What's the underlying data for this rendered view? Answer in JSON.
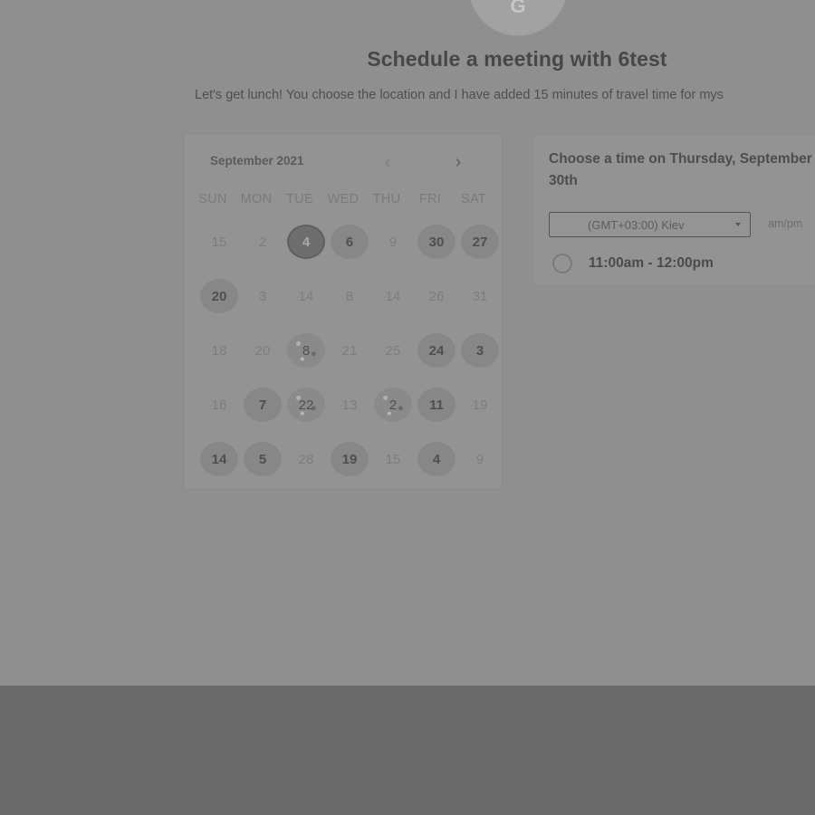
{
  "header": {
    "avatar_glyph": "G",
    "title": "Schedule a meeting with 6test",
    "description": "Let's get lunch! You choose the location and I have added 15 minutes of travel time for mys"
  },
  "calendar": {
    "month_label": "September 2021",
    "prev_icon": "chevron-left-icon",
    "next_icon": "chevron-right-icon",
    "prev_glyph": "‹",
    "next_glyph": "›",
    "weekdays": [
      "SUN",
      "MON",
      "TUE",
      "WED",
      "THU",
      "FRI",
      "SAT"
    ],
    "weeks": [
      [
        {
          "d": "15",
          "s": "off"
        },
        {
          "d": "2",
          "s": "off"
        },
        {
          "d": "4",
          "s": "sel"
        },
        {
          "d": "6",
          "s": "avail"
        },
        {
          "d": "9",
          "s": "off"
        },
        {
          "d": "30",
          "s": "avail"
        },
        {
          "d": "27",
          "s": "avail"
        }
      ],
      [
        {
          "d": "20",
          "s": "avail"
        },
        {
          "d": "3",
          "s": "off"
        },
        {
          "d": "14",
          "s": "off"
        },
        {
          "d": "8",
          "s": "off"
        },
        {
          "d": "14",
          "s": "off"
        },
        {
          "d": "26",
          "s": "off"
        },
        {
          "d": "31",
          "s": "off"
        }
      ],
      [
        {
          "d": "18",
          "s": "off"
        },
        {
          "d": "20",
          "s": "off"
        },
        {
          "d": "8",
          "s": "noisy"
        },
        {
          "d": "21",
          "s": "off"
        },
        {
          "d": "25",
          "s": "off"
        },
        {
          "d": "24",
          "s": "avail"
        },
        {
          "d": "3",
          "s": "avail"
        }
      ],
      [
        {
          "d": "16",
          "s": "off"
        },
        {
          "d": "7",
          "s": "avail"
        },
        {
          "d": "22",
          "s": "noisy"
        },
        {
          "d": "13",
          "s": "off"
        },
        {
          "d": "2",
          "s": "noisy"
        },
        {
          "d": "11",
          "s": "avail"
        },
        {
          "d": "19",
          "s": "off"
        }
      ],
      [
        {
          "d": "14",
          "s": "avail"
        },
        {
          "d": "5",
          "s": "avail"
        },
        {
          "d": "28",
          "s": "off"
        },
        {
          "d": "19",
          "s": "avail"
        },
        {
          "d": "15",
          "s": "off"
        },
        {
          "d": "4",
          "s": "avail"
        },
        {
          "d": "9",
          "s": "off"
        }
      ]
    ]
  },
  "times": {
    "heading": "Choose a time on Thursday, September 30th",
    "timezone": "(GMT+03:00) Kiev",
    "format_toggle": "am/pm",
    "slots": [
      {
        "label": "11:00am - 12:00pm"
      }
    ]
  },
  "colors": {
    "page_bg": "#8f8f8f",
    "footer_bg": "#6a6a6a",
    "card_bg": "#939393"
  }
}
